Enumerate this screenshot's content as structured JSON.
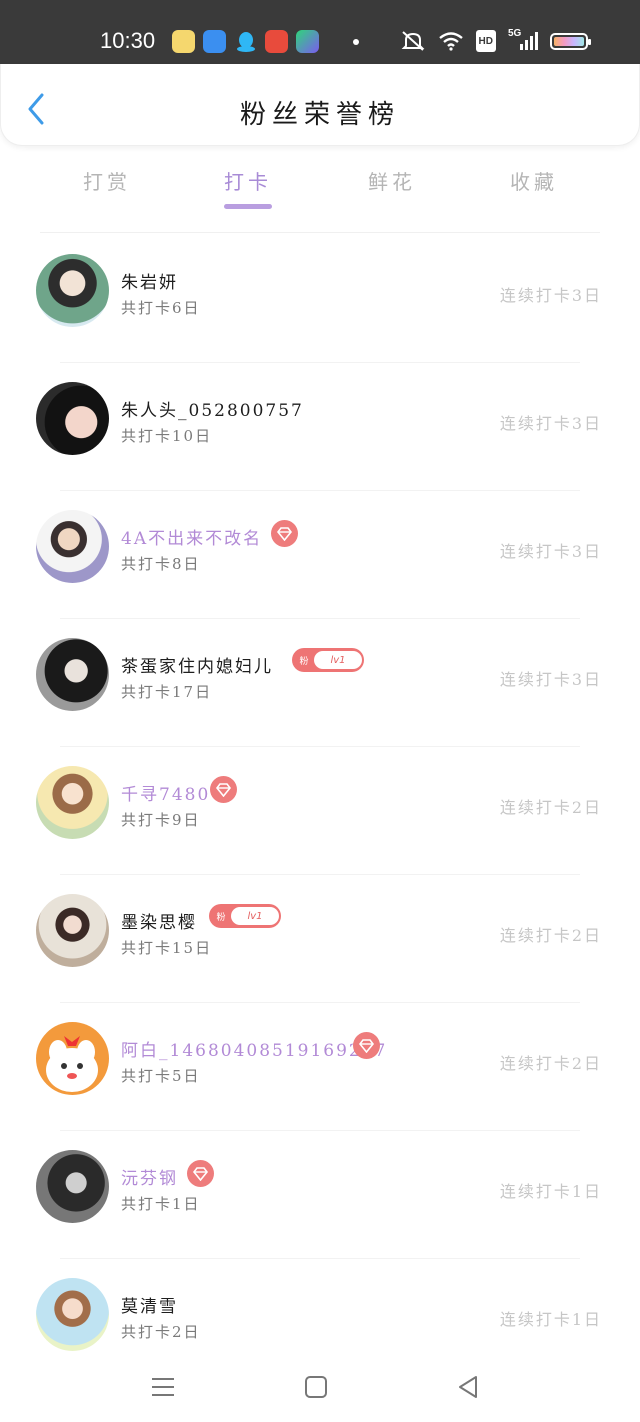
{
  "status": {
    "time": "10:30",
    "network": "5G",
    "hd": "HD"
  },
  "header": {
    "title": "粉丝荣誉榜",
    "back_icon": "chevron-left-icon",
    "accent": "#3e9be8"
  },
  "tabs": [
    {
      "label": "打赏",
      "active": false
    },
    {
      "label": "打卡",
      "active": true
    },
    {
      "label": "鲜花",
      "active": false
    },
    {
      "label": "收藏",
      "active": false
    }
  ],
  "rows": [
    {
      "name": "朱岩妍",
      "total": "共打卡6日",
      "streak": "连续打卡3日",
      "name_color": "default",
      "badge": "none"
    },
    {
      "name": "朱人头_052800757",
      "total": "共打卡10日",
      "streak": "连续打卡3日",
      "name_color": "default",
      "badge": "none"
    },
    {
      "name": "4A不出来不改名",
      "total": "共打卡8日",
      "streak": "连续打卡3日",
      "name_color": "purple",
      "badge": "vip"
    },
    {
      "name": "茶蛋家住内媳妇儿",
      "total": "共打卡17日",
      "streak": "连续打卡3日",
      "name_color": "default",
      "badge": "fan",
      "fan_tag": "粉",
      "fan_level": "lv1"
    },
    {
      "name": "千寻7480",
      "total": "共打卡9日",
      "streak": "连续打卡2日",
      "name_color": "purple",
      "badge": "vip"
    },
    {
      "name": "墨染思樱",
      "total": "共打卡15日",
      "streak": "连续打卡2日",
      "name_color": "default",
      "badge": "fan",
      "fan_tag": "粉",
      "fan_level": "lv1"
    },
    {
      "name": "阿白_14680408519169287",
      "total": "共打卡5日",
      "streak": "连续打卡2日",
      "name_color": "purple",
      "badge": "vip"
    },
    {
      "name": "沅芬钢",
      "total": "共打卡1日",
      "streak": "连续打卡1日",
      "name_color": "purple",
      "badge": "vip"
    },
    {
      "name": "莫清雪",
      "total": "共打卡2日",
      "streak": "连续打卡1日",
      "name_color": "default",
      "badge": "none"
    }
  ],
  "nav": {
    "menu_icon": "menu-icon",
    "home_icon": "home-square-icon",
    "back_icon": "back-triangle-icon"
  }
}
